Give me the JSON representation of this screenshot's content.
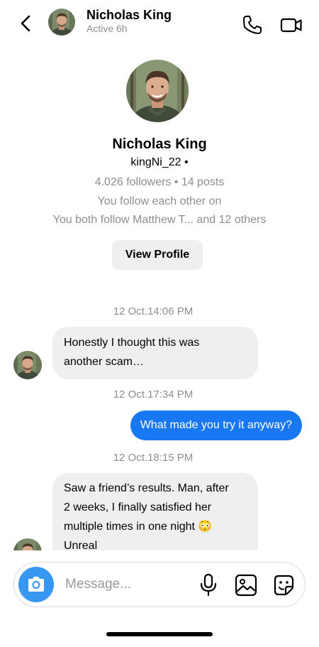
{
  "header": {
    "name": "Nicholas King",
    "status": "Active 6h"
  },
  "profile": {
    "name": "Nicholas King",
    "username": "kingNi_22  •",
    "stats": "4.026 followers • 14 posts",
    "follow_status": "You follow each other on",
    "mutual": "You both follow  Matthew T... and  12 others",
    "view_profile_label": "View Profile"
  },
  "messages": [
    {
      "timestamp": "12 Oct.14:06 PM",
      "direction": "in",
      "lines": [
        "Honestly I thought this was",
        "another scam…"
      ]
    },
    {
      "timestamp": "12 Oct.17:34 PM",
      "direction": "out",
      "text": "What made you try it anyway?"
    },
    {
      "timestamp": "12 Oct.18:15 PM",
      "direction": "in",
      "lines": [
        "Saw a friend’s results. Man, after",
        "2 weeks, I finally satisfied her",
        "multiple times in one night 😳",
        "Unreal"
      ]
    }
  ],
  "composer": {
    "placeholder": "Message..."
  },
  "colors": {
    "accent": "#1877f2",
    "camera": "#3897f0",
    "bubble_in": "#efefef",
    "muted_text": "#8e8e8e"
  },
  "icons": [
    "back-chevron-icon",
    "phone-icon",
    "video-camera-icon",
    "camera-icon",
    "microphone-icon",
    "gallery-icon",
    "sticker-icon"
  ]
}
